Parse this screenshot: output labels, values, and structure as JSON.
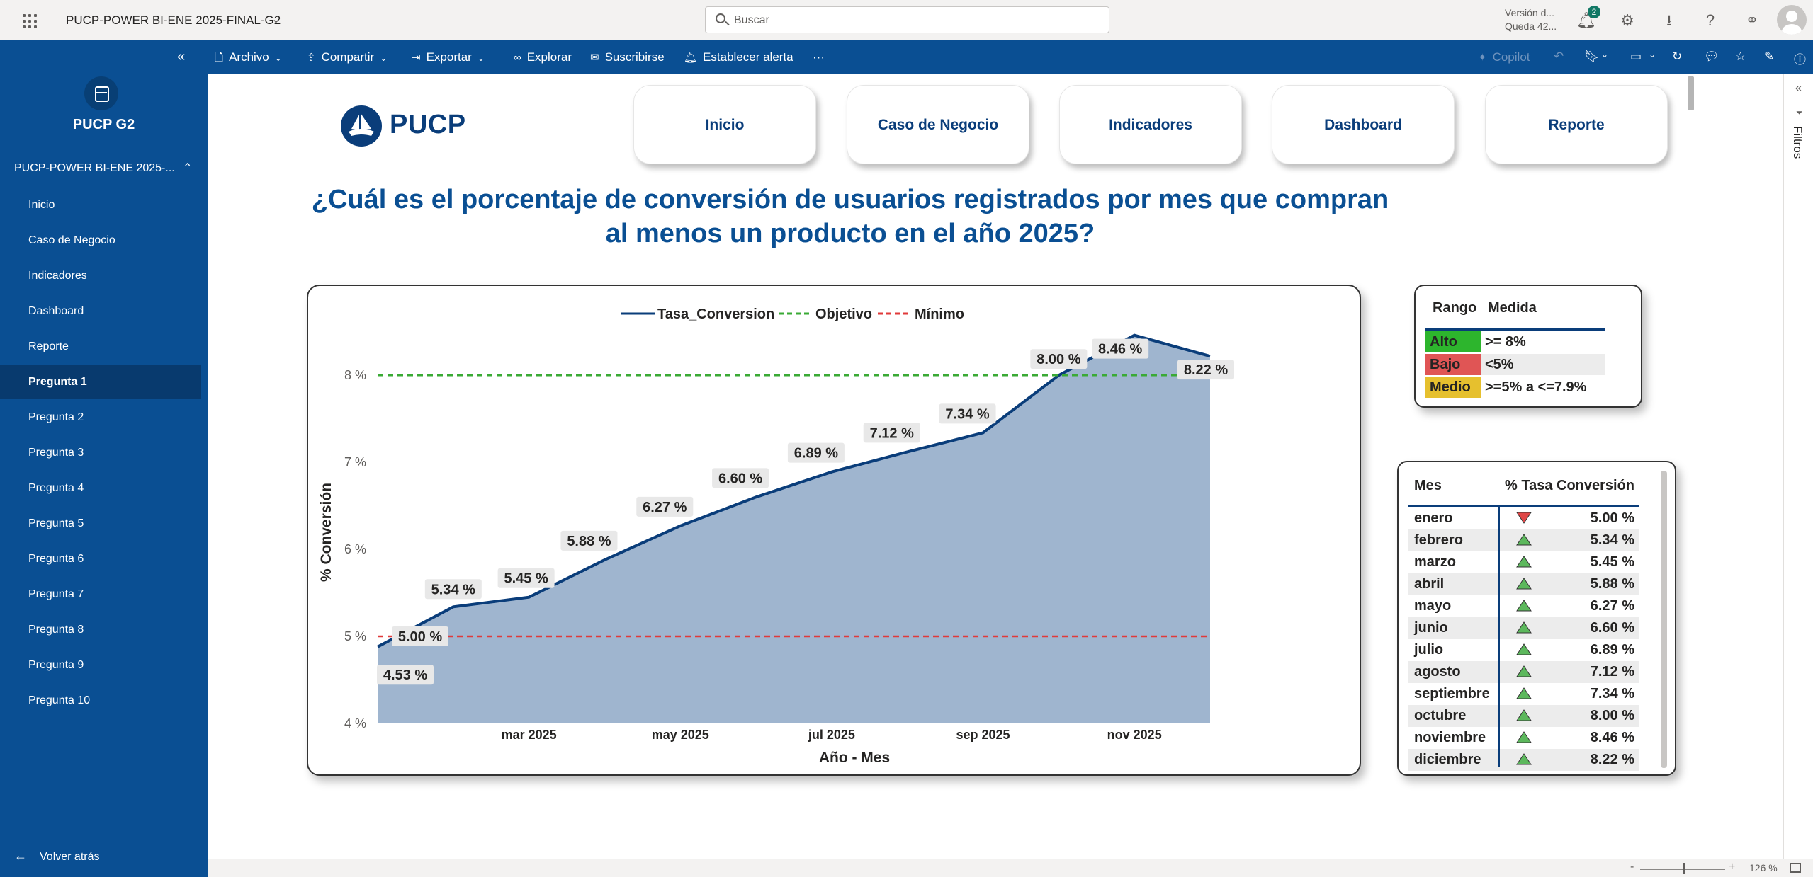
{
  "topbar": {
    "report_title": "PUCP-POWER BI-ENE 2025-FINAL-G2",
    "search_placeholder": "Buscar",
    "version_line1": "Versión d...",
    "version_line2": "Queda 42...",
    "notification_count": "2"
  },
  "nav": {
    "workspace_name": "PUCP G2",
    "app_name": "PUCP-POWER BI-ENE 2025-...",
    "items": [
      {
        "label": "Inicio"
      },
      {
        "label": "Caso de Negocio"
      },
      {
        "label": "Indicadores"
      },
      {
        "label": "Dashboard"
      },
      {
        "label": "Reporte"
      },
      {
        "label": "Pregunta 1"
      },
      {
        "label": "Pregunta 2"
      },
      {
        "label": "Pregunta 3"
      },
      {
        "label": "Pregunta 4"
      },
      {
        "label": "Pregunta 5"
      },
      {
        "label": "Pregunta 6"
      },
      {
        "label": "Pregunta 7"
      },
      {
        "label": "Pregunta 8"
      },
      {
        "label": "Pregunta 9"
      },
      {
        "label": "Pregunta 10"
      }
    ],
    "active_item": "Pregunta 1",
    "back_label": "Volver atrás"
  },
  "toolbar": {
    "archivo": "Archivo",
    "compartir": "Compartir",
    "exportar": "Exportar",
    "explorar": "Explorar",
    "suscribirse": "Suscribirse",
    "alerta": "Establecer alerta",
    "more": "···",
    "copilot": "Copilot"
  },
  "report": {
    "logo_text": "PUCP",
    "buttons": [
      "Inicio",
      "Caso de Negocio",
      "Indicadores",
      "Dashboard",
      "Reporte"
    ],
    "question": "¿Cuál es el porcentaje de conversión de usuarios registrados por mes que compran al menos un producto en el año 2025?"
  },
  "chart_data": {
    "type": "area",
    "legend": [
      "Tasa_Conversion",
      "Objetivo",
      "Mínimo"
    ],
    "legend_position": "top-center",
    "xlabel": "Año - Mes",
    "ylabel": "% Conversión",
    "x_tick_labels": [
      "mar 2025",
      "may 2025",
      "jul 2025",
      "sep 2025",
      "nov 2025"
    ],
    "x_tick_index": [
      2,
      4,
      6,
      8,
      10
    ],
    "y_ticks": [
      4,
      5,
      6,
      7,
      8
    ],
    "y_tick_labels": [
      "4 %",
      "5 %",
      "6 %",
      "7 %",
      "8 %"
    ],
    "ylim": [
      4,
      8.75
    ],
    "series": [
      {
        "name": "Tasa_Conversion",
        "values": [
          4.88,
          5.34,
          5.45,
          5.88,
          6.27,
          6.6,
          6.89,
          7.12,
          7.34,
          8.0,
          8.46,
          8.22
        ],
        "color": "#0a3d7a",
        "fill": "#9fb5cf"
      },
      {
        "name": "Objetivo",
        "value": 8,
        "color": "#3aaa35",
        "dashed": true
      },
      {
        "name": "Mínimo",
        "value": 5,
        "color": "#e03a3a",
        "dashed": true
      }
    ],
    "data_labels": [
      "5.00 %",
      "5.34 %",
      "5.45 %",
      "5.88 %",
      "6.27 %",
      "6.60 %",
      "6.89 %",
      "7.12 %",
      "7.34 %",
      "8.00 %",
      "8.46 %",
      "8.22 %"
    ],
    "extra_label": "4.53 %"
  },
  "range_legend": {
    "header_rango": "Rango",
    "header_medida": "Medida",
    "rows": [
      {
        "name": "Alto",
        "measure": ">= 8%",
        "color": "#2db52d"
      },
      {
        "name": "Bajo",
        "measure": "<5%",
        "color": "#e05555"
      },
      {
        "name": "Medio",
        "measure": ">=5% a <=7.9%",
        "color": "#e6c02e"
      }
    ]
  },
  "month_table": {
    "header_mes": "Mes",
    "header_tasa": "% Tasa Conversión",
    "rows": [
      {
        "month": "enero",
        "value": "5.00 %",
        "trend": "down"
      },
      {
        "month": "febrero",
        "value": "5.34 %",
        "trend": "up"
      },
      {
        "month": "marzo",
        "value": "5.45 %",
        "trend": "up"
      },
      {
        "month": "abril",
        "value": "5.88 %",
        "trend": "up"
      },
      {
        "month": "mayo",
        "value": "6.27 %",
        "trend": "up"
      },
      {
        "month": "junio",
        "value": "6.60 %",
        "trend": "up"
      },
      {
        "month": "julio",
        "value": "6.89 %",
        "trend": "up"
      },
      {
        "month": "agosto",
        "value": "7.12 %",
        "trend": "up"
      },
      {
        "month": "septiembre",
        "value": "7.34 %",
        "trend": "up"
      },
      {
        "month": "octubre",
        "value": "8.00 %",
        "trend": "up"
      },
      {
        "month": "noviembre",
        "value": "8.46 %",
        "trend": "up"
      },
      {
        "month": "diciembre",
        "value": "8.22 %",
        "trend": "up"
      }
    ]
  },
  "statusbar": {
    "zoom_level": "126 %"
  }
}
